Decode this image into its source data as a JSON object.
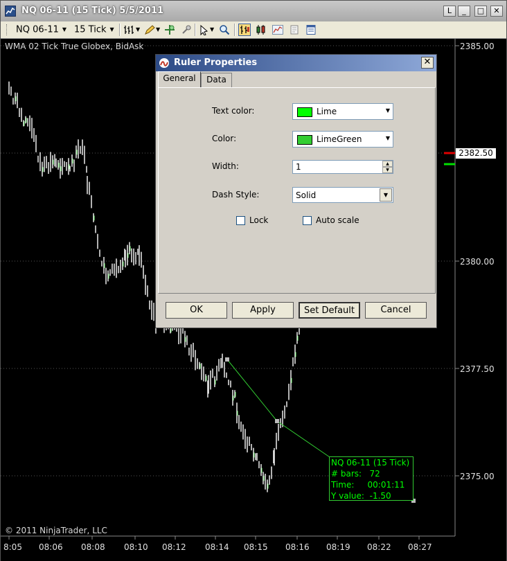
{
  "window": {
    "title": "NQ 06-11 (15 Tick)  5/5/2011",
    "buttons": {
      "link": "L",
      "minimize": "_",
      "maximize": "□",
      "close": "✕"
    }
  },
  "toolbar": {
    "instrument": "NQ 06-11",
    "period": "15 Tick"
  },
  "chart": {
    "indicator_label": "WMA 02 Tick True Globex, BidAsk",
    "copyright": "© 2011 NinjaTrader, LLC",
    "price_labels": [
      "2385.00",
      "2380.00",
      "2377.50",
      "2375.00"
    ],
    "current_price": "2382.50",
    "time_labels": [
      "8:05",
      "08:06",
      "08:08",
      "08:10",
      "08:12",
      "08:14",
      "08:15",
      "08:16",
      "08:19",
      "08:22",
      "08:27"
    ],
    "colors": {
      "bars": "#ffffff",
      "ruler": "#32cd32",
      "ruler_text": "#00ff00",
      "marker_red": "#e00000",
      "marker_green": "#00e000"
    }
  },
  "ruler_box": {
    "title": "NQ 06-11 (15 Tick)",
    "bars_label": "# bars:",
    "bars_value": "72",
    "time_label": "Time:",
    "time_value": "00:01:11",
    "y_label": "Y value:",
    "y_value": "-1.50"
  },
  "dialog": {
    "title": "Ruler Properties",
    "close": "✕",
    "tabs": [
      "General",
      "Data"
    ],
    "fields": {
      "text_color_label": "Text color:",
      "text_color_value": "Lime",
      "text_color_hex": "#00ff00",
      "color_label": "Color:",
      "color_value": "LimeGreen",
      "color_hex": "#32cd32",
      "width_label": "Width:",
      "width_value": "1",
      "dash_label": "Dash Style:",
      "dash_value": "Solid",
      "lock_label": "Lock",
      "autoscale_label": "Auto scale"
    },
    "buttons": [
      "OK",
      "Apply",
      "Set Default",
      "Cancel"
    ]
  }
}
